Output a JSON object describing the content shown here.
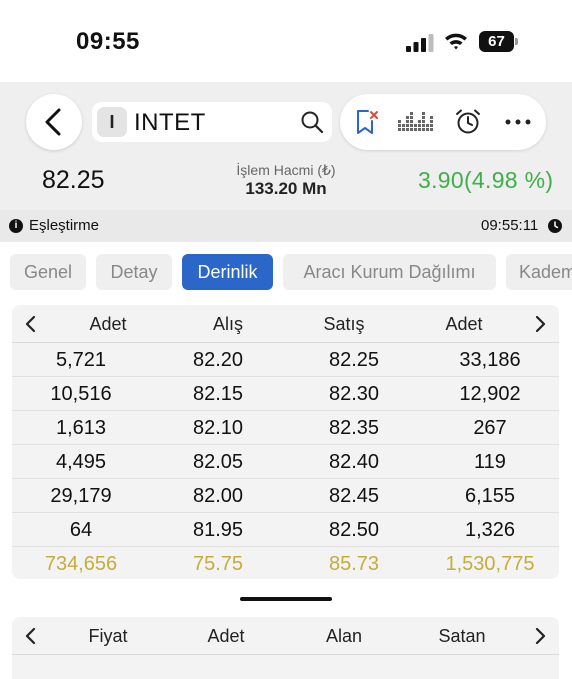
{
  "status_bar": {
    "time": "09:55",
    "battery": "67"
  },
  "header": {
    "symbol_badge": "I",
    "symbol": "INTET",
    "price": "82.25",
    "volume_label": "İşlem Hacmi (₺)",
    "volume_value": "133.20 Mn",
    "change": "3.90",
    "change_percent": "(4.98 %)",
    "change_color": "#3fae4b",
    "icons": [
      "back-icon",
      "search-icon",
      "bookmark-icon",
      "depth-grid-icon",
      "alarm-icon",
      "more-icon"
    ]
  },
  "match_bar": {
    "label": "Eşleştirme",
    "time": "09:55:11"
  },
  "tabs": [
    {
      "label": "Genel",
      "active": false
    },
    {
      "label": "Detay",
      "active": false
    },
    {
      "label": "Derinlik",
      "active": true
    },
    {
      "label": "Aracı Kurum Dağılımı",
      "active": false
    },
    {
      "label": "Kademe",
      "active": false
    }
  ],
  "depth": {
    "headers": [
      "Adet",
      "Alış",
      "Satış",
      "Adet"
    ],
    "rows": [
      [
        "5,721",
        "82.20",
        "82.25",
        "33,186"
      ],
      [
        "10,516",
        "82.15",
        "82.30",
        "12,902"
      ],
      [
        "1,613",
        "82.10",
        "82.35",
        "267"
      ],
      [
        "4,495",
        "82.05",
        "82.40",
        "119"
      ],
      [
        "29,179",
        "82.00",
        "82.45",
        "6,155"
      ],
      [
        "64",
        "81.95",
        "82.50",
        "1,326"
      ]
    ],
    "total": [
      "734,656",
      "75.75",
      "85.73",
      "1,530,775"
    ],
    "total_color": "#c5ad3c"
  },
  "trades": {
    "headers": [
      "Fiyat",
      "Adet",
      "Alan",
      "Satan"
    ]
  },
  "accent_color": "#2b67c8"
}
